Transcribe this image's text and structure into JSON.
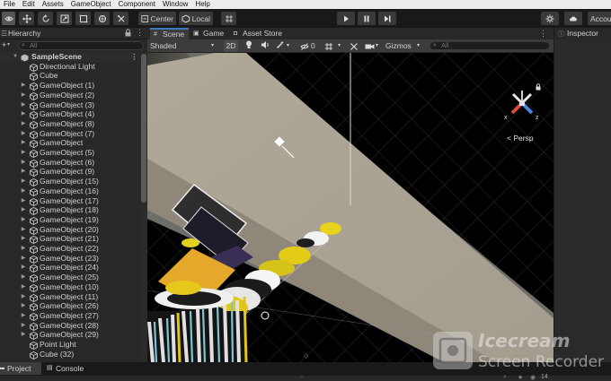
{
  "menu": [
    "File",
    "Edit",
    "Assets",
    "GameObject",
    "Component",
    "Window",
    "Help"
  ],
  "toolbar": {
    "center_label": "Center",
    "local_label": "Local",
    "account_label": "Accou"
  },
  "hierarchy": {
    "title": "Hierarchy",
    "add_label": "+",
    "search_placeholder": "All",
    "scene_name": "SampleScene",
    "items": [
      {
        "label": "Directional Light",
        "expand": false
      },
      {
        "label": "Cube",
        "expand": false
      },
      {
        "label": "GameObject (1)",
        "expand": true
      },
      {
        "label": "GameObject (2)",
        "expand": true
      },
      {
        "label": "GameObject (3)",
        "expand": true
      },
      {
        "label": "GameObject (4)",
        "expand": true
      },
      {
        "label": "GameObject (8)",
        "expand": true
      },
      {
        "label": "GameObject (7)",
        "expand": true
      },
      {
        "label": "GameObject",
        "expand": true
      },
      {
        "label": "GameObject (5)",
        "expand": true
      },
      {
        "label": "GameObject (6)",
        "expand": true
      },
      {
        "label": "GameObject (9)",
        "expand": true
      },
      {
        "label": "GameObject (15)",
        "expand": true
      },
      {
        "label": "GameObject (16)",
        "expand": true
      },
      {
        "label": "GameObject (17)",
        "expand": true
      },
      {
        "label": "GameObject (18)",
        "expand": true
      },
      {
        "label": "GameObject (19)",
        "expand": true
      },
      {
        "label": "GameObject (20)",
        "expand": true
      },
      {
        "label": "GameObject (21)",
        "expand": true
      },
      {
        "label": "GameObject (22)",
        "expand": true
      },
      {
        "label": "GameObject (23)",
        "expand": true
      },
      {
        "label": "GameObject (24)",
        "expand": true
      },
      {
        "label": "GameObject (25)",
        "expand": true
      },
      {
        "label": "GameObject (10)",
        "expand": true
      },
      {
        "label": "GameObject (11)",
        "expand": true
      },
      {
        "label": "GameObject (26)",
        "expand": true
      },
      {
        "label": "GameObject (27)",
        "expand": true
      },
      {
        "label": "GameObject (28)",
        "expand": true
      },
      {
        "label": "GameObject (29)",
        "expand": true
      },
      {
        "label": "Point Light",
        "expand": false
      },
      {
        "label": "Cube (32)",
        "expand": false
      }
    ]
  },
  "scene": {
    "tabs": [
      "Scene",
      "Game",
      "Asset Store"
    ],
    "shading_mode": "Shaded",
    "two_d_label": "2D",
    "hidden_count": "0",
    "gizmos_label": "Gizmos",
    "search_placeholder": "All",
    "persp_label": "Persp",
    "axis_x": "x",
    "axis_z": "z"
  },
  "inspector": {
    "title": "Inspector"
  },
  "bottom_tabs": [
    "Project",
    "Console"
  ],
  "status": {
    "count": "14"
  },
  "watermark": {
    "line1": "Icecream",
    "line2": "Screen Recorder"
  },
  "colors": {
    "accent": "#3a79bb",
    "panel": "#282828",
    "toolbar": "#3c3c3c",
    "floor": "#a8a094",
    "yellow": "#e8c21c"
  }
}
